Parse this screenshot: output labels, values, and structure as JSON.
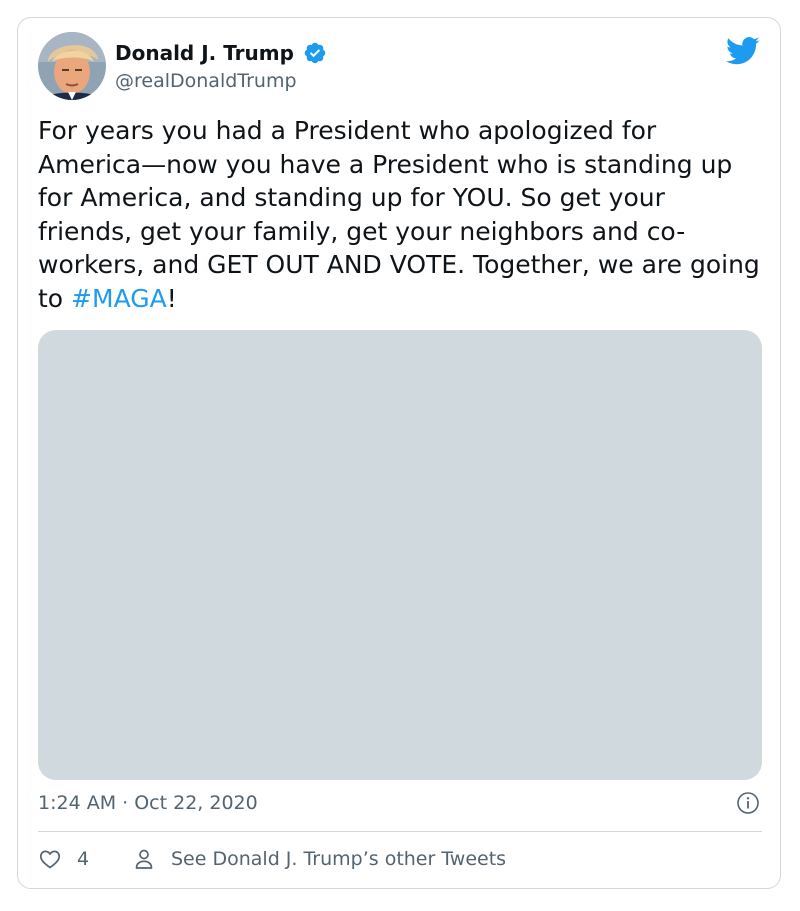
{
  "author": {
    "display_name": "Donald J. Trump",
    "handle": "@realDonaldTrump",
    "verified": true,
    "avatar_icon": "profile-photo"
  },
  "tweet": {
    "text_before_hashtag": "For years you had a President who apologized for America—now you have a President who is standing up for America, and standing up for YOU. So get your friends, get your family, get your neighbors and co-workers, and GET OUT AND VOTE. Together, we are going to ",
    "hashtag": "#MAGA",
    "text_after_hashtag": "!",
    "timestamp": "1:24 AM · Oct 22, 2020"
  },
  "actions": {
    "like_count": "4",
    "profile_link_label": "See Donald J. Trump’s other Tweets"
  },
  "icons": {
    "brand": "twitter-bird-icon",
    "verified": "verified-badge-icon",
    "info": "info-icon",
    "like": "heart-icon",
    "profile": "person-icon"
  },
  "colors": {
    "brand_blue": "#1d9bf0",
    "text_primary": "#0f1419",
    "text_secondary": "#536471",
    "border": "#cfd9de",
    "media_placeholder": "#cfd9de"
  }
}
